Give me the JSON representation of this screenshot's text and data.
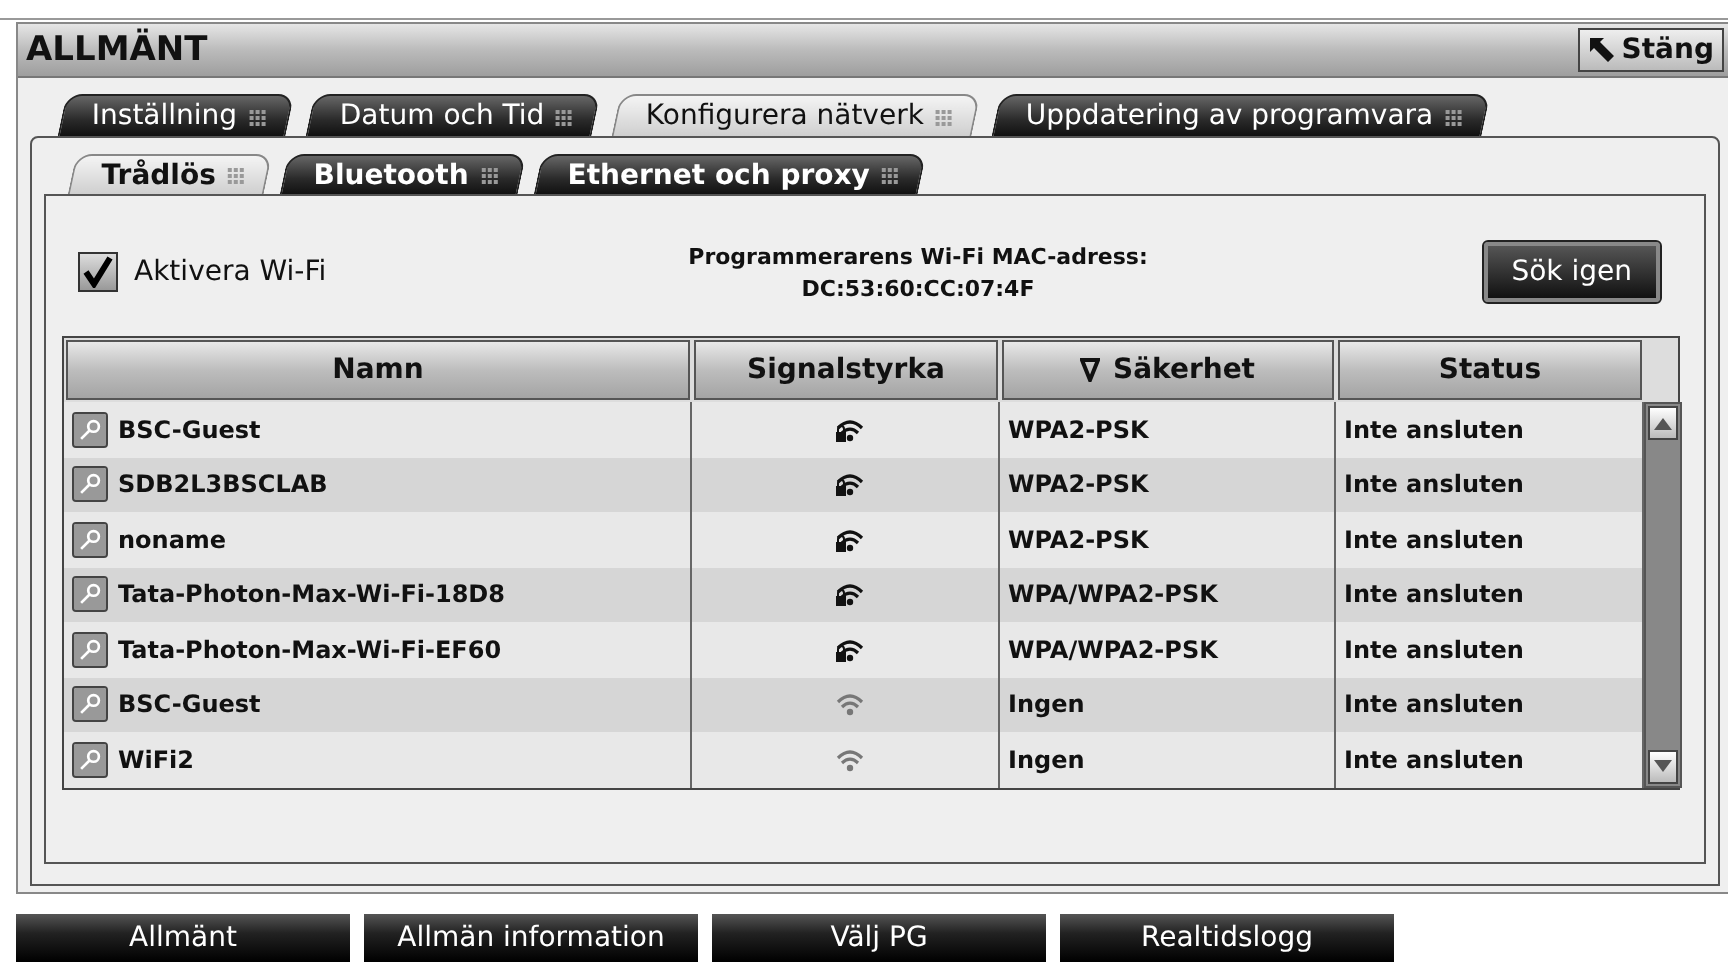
{
  "header": {
    "title": "ALLMÄNT",
    "close_button": "Stäng"
  },
  "tabs": [
    {
      "label": "Inställning",
      "selected": false
    },
    {
      "label": "Datum och Tid",
      "selected": false
    },
    {
      "label": "Konfigurera nätverk",
      "selected": true
    },
    {
      "label": "Uppdatering av programvara",
      "selected": false
    }
  ],
  "subtabs": [
    {
      "label": "Trådlös",
      "selected": true
    },
    {
      "label": "Bluetooth",
      "selected": false
    },
    {
      "label": "Ethernet och proxy",
      "selected": false
    }
  ],
  "wifi_toggle": {
    "label": "Aktivera Wi-Fi",
    "checked": true
  },
  "mac_address": {
    "label": "Programmerarens Wi-Fi MAC-adress:",
    "value": "DC:53:60:CC:07:4F"
  },
  "rescan_button": "Sök igen",
  "table": {
    "columns": [
      {
        "label": "Namn",
        "sorted": false
      },
      {
        "label": "Signalstyrka",
        "sorted": false
      },
      {
        "label": "Säkerhet",
        "sorted": true
      },
      {
        "label": "Status",
        "sorted": false
      }
    ],
    "rows": [
      {
        "name": "BSC-Guest",
        "locked": true,
        "security": "WPA2-PSK",
        "status": "Inte ansluten"
      },
      {
        "name": "SDB2L3BSCLAB",
        "locked": true,
        "security": "WPA2-PSK",
        "status": "Inte ansluten"
      },
      {
        "name": "noname",
        "locked": true,
        "security": "WPA2-PSK",
        "status": "Inte ansluten"
      },
      {
        "name": "Tata-Photon-Max-Wi-Fi-18D8",
        "locked": true,
        "security": "WPA/WPA2-PSK",
        "status": "Inte ansluten"
      },
      {
        "name": "Tata-Photon-Max-Wi-Fi-EF60",
        "locked": true,
        "security": "WPA/WPA2-PSK",
        "status": "Inte ansluten"
      },
      {
        "name": "BSC-Guest",
        "locked": false,
        "security": "Ingen",
        "status": "Inte ansluten"
      },
      {
        "name": "WiFi2",
        "locked": false,
        "security": "Ingen",
        "status": "Inte ansluten"
      }
    ]
  },
  "nav_buttons": [
    "Allmänt",
    "Allmän information",
    "Välj PG",
    "Realtidslogg"
  ]
}
